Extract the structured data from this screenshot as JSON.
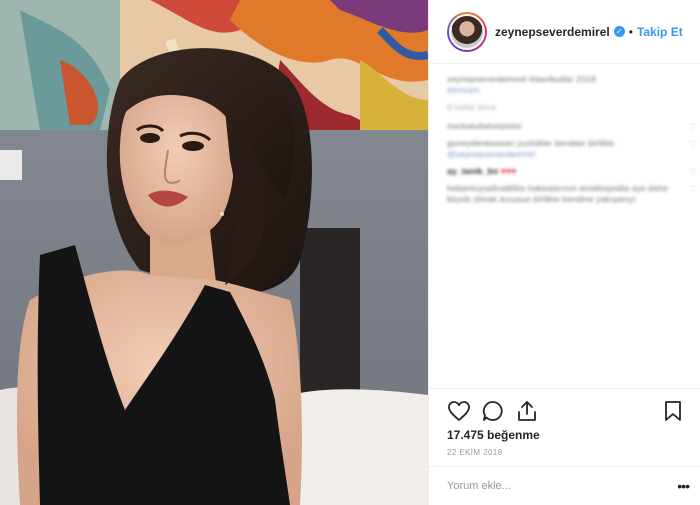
{
  "post": {
    "username": "zeynepseverdemirel",
    "verified_icon": "verified-badge-icon",
    "separator": "•",
    "follow_label": "Takip Et"
  },
  "caption": {
    "line1": "zeynepseverdemirel #dantkutlar 2018",
    "line2": "#ömrüm",
    "time": "8 hafta önce"
  },
  "comments": [
    {
      "text": "merkatullahmümini"
    },
    {
      "text": "guneydenkaasan yuzlukler beraber birlikte",
      "mention": "@zeynepseverdemirel"
    },
    {
      "user": "ay_tanik_bn",
      "hearts": "♥♥♥"
    },
    {
      "text": "hebantuysallıadtikis hakaalarının ansiklopedia ays daha büyük olmak arzusun birlikte kendine yakışanıyı"
    }
  ],
  "actions": {
    "like_icon": "heart-icon",
    "comment_icon": "comment-icon",
    "share_icon": "share-icon",
    "save_icon": "bookmark-icon"
  },
  "likes": {
    "count": "17.475",
    "label": "beğenme"
  },
  "date": "22 EKİM 2018",
  "add_comment": {
    "placeholder": "Yorum ekle...",
    "more_label": "•••"
  },
  "colors": {
    "link_blue": "#3897f0",
    "border": "#efefef",
    "text": "#262626"
  }
}
